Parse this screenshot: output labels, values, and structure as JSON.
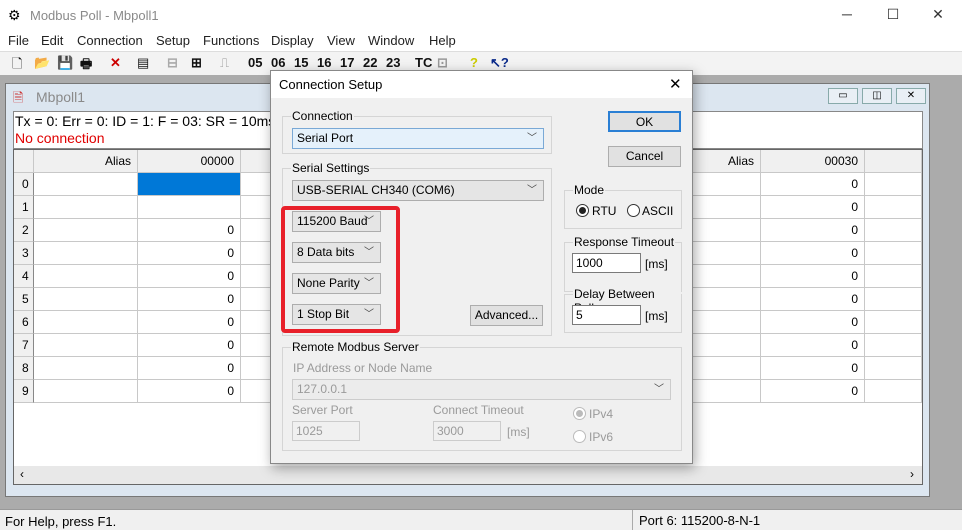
{
  "app": {
    "title": "Modbus Poll - Mbpoll1",
    "minimize": "─",
    "maximize": "☐",
    "close": "✕"
  },
  "menu": [
    "File",
    "Edit",
    "Connection",
    "Setup",
    "Functions",
    "Display",
    "View",
    "Window",
    "Help"
  ],
  "toolbar": {
    "codes": [
      "05",
      "06",
      "15",
      "16",
      "17",
      "22",
      "23"
    ],
    "tc": "TC"
  },
  "child": {
    "title": "Mbpoll1",
    "status_line": "Tx = 0: Err = 0: ID = 1: F = 03: SR = 10ms",
    "connection_status": "No connection",
    "connection_status_color": "#e00000"
  },
  "grid": {
    "left_headers": [
      "Alias",
      "00000"
    ],
    "right_headers": [
      "Alias",
      "00030"
    ],
    "row_numbers": [
      "0",
      "1",
      "2",
      "3",
      "4",
      "5",
      "6",
      "7",
      "8",
      "9"
    ],
    "left_values": [
      "",
      "",
      "0",
      "0",
      "0",
      "0",
      "0",
      "0",
      "0",
      "0"
    ],
    "right_values": [
      "0",
      "0",
      "0",
      "0",
      "0",
      "0",
      "0",
      "0",
      "0",
      "0"
    ],
    "selected_color": "#0078d7"
  },
  "statusbar": {
    "help": "For Help, press F1.",
    "port": "Port 6: 115200-8-N-1"
  },
  "dialog": {
    "title": "Connection Setup",
    "close": "✕",
    "connection_label": "Connection",
    "connection_value": "Serial Port",
    "ok": "OK",
    "cancel": "Cancel",
    "serial_label": "Serial Settings",
    "port_value": "USB-SERIAL CH340 (COM6)",
    "baud": "115200 Baud",
    "data_bits": "8 Data bits",
    "parity": "None Parity",
    "stop_bits": "1 Stop Bit",
    "advanced": "Advanced...",
    "mode_label": "Mode",
    "mode_rtu": "RTU",
    "mode_ascii": "ASCII",
    "mode_selected": "RTU",
    "response_timeout_label": "Response Timeout",
    "response_timeout": "1000",
    "ms": "[ms]",
    "delay_label": "Delay Between Polls",
    "delay": "5",
    "remote_label": "Remote Modbus Server",
    "ip_label": "IP Address or Node Name",
    "ip_value": "127.0.0.1",
    "server_port_label": "Server Port",
    "server_port": "1025",
    "connect_timeout_label": "Connect Timeout",
    "connect_timeout": "3000",
    "ipv4": "IPv4",
    "ipv6": "IPv6",
    "ip_selected": "IPv4",
    "highlight_color": "#e8202a"
  }
}
